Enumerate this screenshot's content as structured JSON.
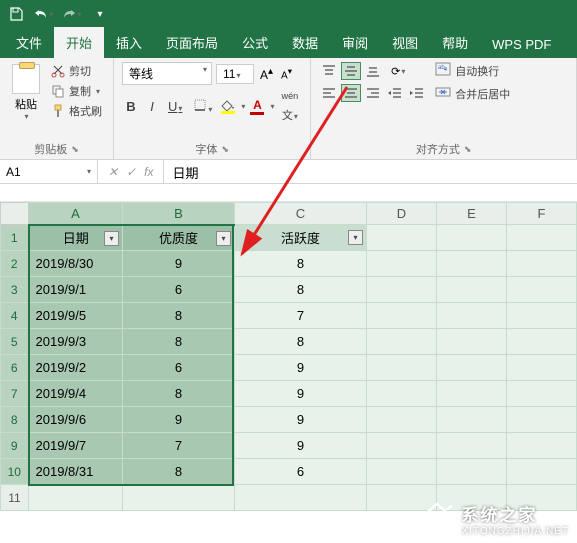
{
  "titlebar": {
    "save": "Save",
    "undo": "Undo",
    "redo": "Redo"
  },
  "tabs": {
    "file": "文件",
    "home": "开始",
    "insert": "插入",
    "layout": "页面布局",
    "formula": "公式",
    "data": "数据",
    "review": "审阅",
    "view": "视图",
    "help": "帮助",
    "wps": "WPS PDF"
  },
  "ribbon": {
    "clipboard": {
      "paste": "粘贴",
      "cut": "剪切",
      "copy": "复制",
      "format_painter": "格式刷",
      "group_label": "剪贴板"
    },
    "font": {
      "name": "等线",
      "size": "11",
      "group_label": "字体",
      "bold": "B",
      "italic": "I",
      "underline": "U",
      "inc": "A",
      "dec": "A"
    },
    "align": {
      "wrap": "自动换行",
      "merge": "合并后居中",
      "group_label": "对齐方式"
    }
  },
  "formula_bar": {
    "cell_ref": "A1",
    "value": "日期"
  },
  "columns": [
    "A",
    "B",
    "C",
    "D",
    "E",
    "F"
  ],
  "headers": {
    "date": "日期",
    "quality": "优质度",
    "activity": "活跃度"
  },
  "chart_data": {
    "type": "table",
    "columns": [
      "日期",
      "优质度",
      "活跃度"
    ],
    "rows": [
      {
        "date": "2019/8/30",
        "quality": 9,
        "activity": 8
      },
      {
        "date": "2019/9/1",
        "quality": 6,
        "activity": 8
      },
      {
        "date": "2019/9/5",
        "quality": 8,
        "activity": 7
      },
      {
        "date": "2019/9/3",
        "quality": 8,
        "activity": 8
      },
      {
        "date": "2019/9/2",
        "quality": 6,
        "activity": 9
      },
      {
        "date": "2019/9/4",
        "quality": 8,
        "activity": 9
      },
      {
        "date": "2019/9/6",
        "quality": 9,
        "activity": 9
      },
      {
        "date": "2019/9/7",
        "quality": 7,
        "activity": 9
      },
      {
        "date": "2019/8/31",
        "quality": 8,
        "activity": 6
      }
    ]
  },
  "watermark": {
    "title": "系统之家",
    "url": "XITONGZHIJIA.NET"
  }
}
